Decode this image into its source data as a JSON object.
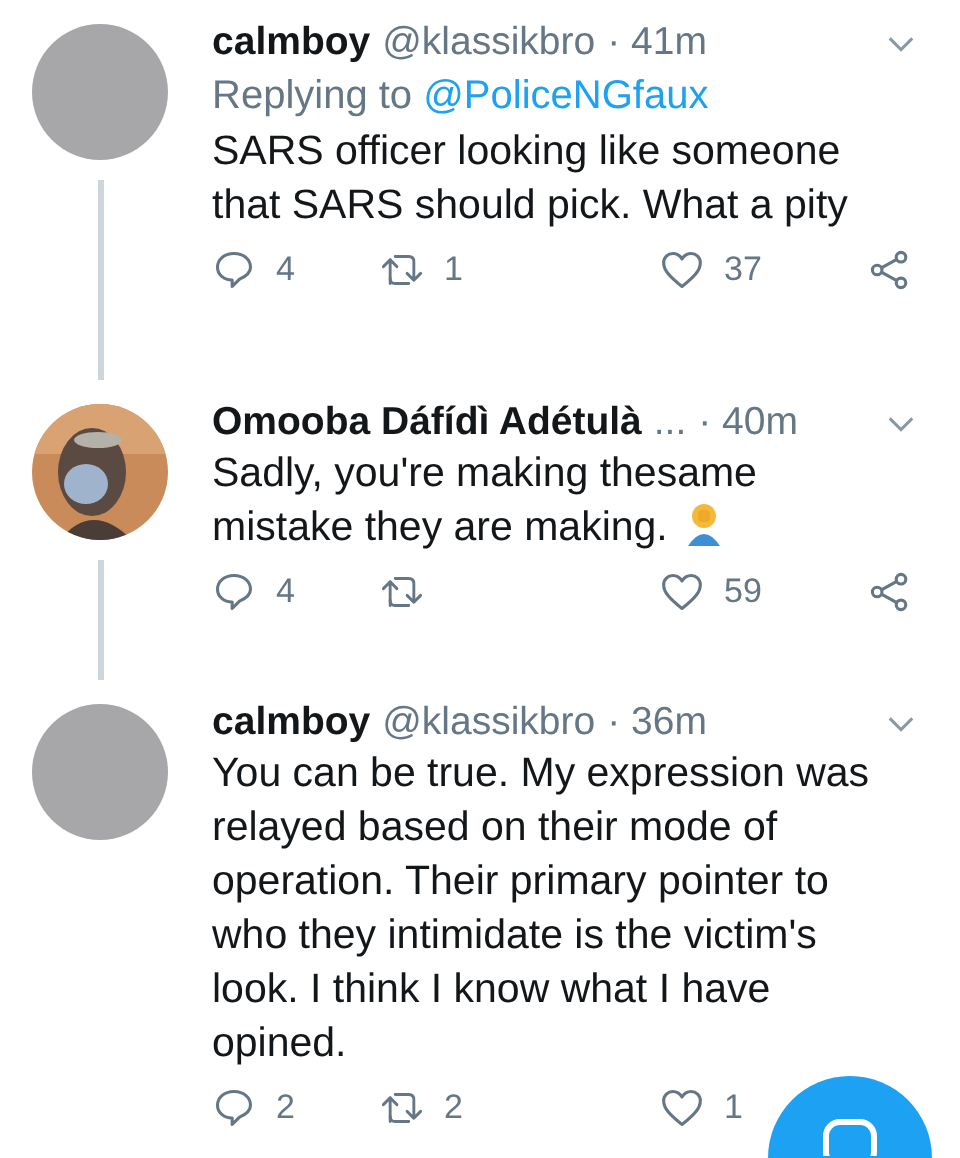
{
  "tweets": [
    {
      "avatar": {
        "kind": "plain"
      },
      "name": "calmboy",
      "handle": "@klassikbro",
      "time": "· 41m",
      "reply_to": {
        "prefix": "Replying to",
        "handle": "@PoliceNGfaux"
      },
      "text": "SARS officer looking like someone that SARS should pick. What a pity",
      "emoji": false,
      "replies": "4",
      "retweets": "1",
      "likes": "37",
      "share": true
    },
    {
      "name": "Omooba Dáfídì Adétulà",
      "handle": "...",
      "time": "· 40m",
      "text": "Sadly, you're making thesame mistake they are making.",
      "emoji": true,
      "replies": "4",
      "likes": "59",
      "share": true
    },
    {
      "avatar": {
        "kind": "plain"
      },
      "name": "calmboy",
      "handle": "@klassikbro",
      "time": "· 36m",
      "text": "You can be true. My expression was relayed based on their mode of operation. Their primary pointer to who they intimidate is the victim's look. I think I know what I have opined.",
      "emoji": false,
      "replies": "2",
      "retweets": "2",
      "likes": "1",
      "share": false
    }
  ],
  "compose_button": {
    "kind": "fab"
  }
}
